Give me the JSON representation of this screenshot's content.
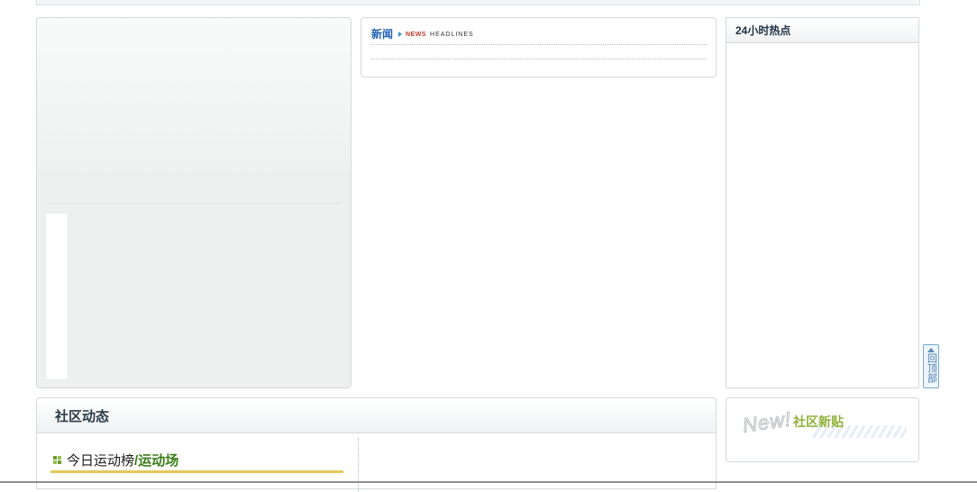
{
  "news": {
    "title": "新闻",
    "badge": "NEWS",
    "subtitle": "HEADLINES"
  },
  "hot": {
    "title": "24小时热点"
  },
  "back_to_top": {
    "label": "回顶部",
    "icon": "up-arrow-icon"
  },
  "community": {
    "title": "社区动态",
    "ranking": {
      "title_part1": "今日运动榜",
      "separator": "/",
      "title_part2": "运动场",
      "icon": "grid-icon"
    }
  },
  "new_posts": {
    "logo": "New!",
    "title": "社区新贴"
  },
  "colors": {
    "accent_blue": "#1f62b5",
    "accent_green": "#3a7d17",
    "new_green": "#8fb13b",
    "underline_gold": "#e4c85a"
  }
}
